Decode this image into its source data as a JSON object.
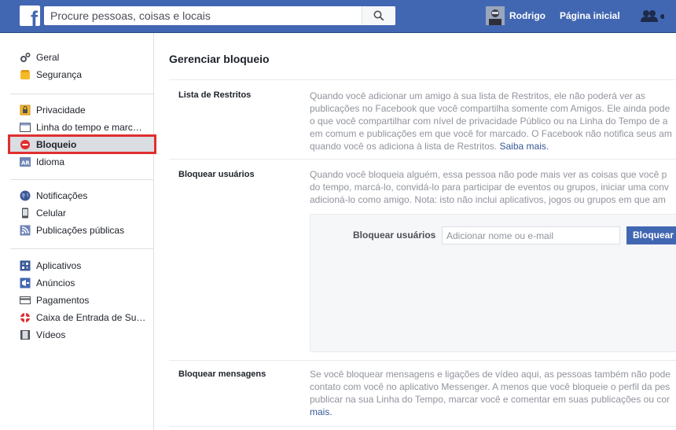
{
  "topbar": {
    "logo": "f",
    "search_placeholder": "Procure pessoas, coisas e locais",
    "user_name": "Rodrigo",
    "home_label": "Página inicial"
  },
  "sidebar": {
    "group1": [
      {
        "label": "Geral",
        "icon": "gears-icon"
      },
      {
        "label": "Segurança",
        "icon": "shield-icon"
      }
    ],
    "group2": [
      {
        "label": "Privacidade",
        "icon": "lock-icon"
      },
      {
        "label": "Linha do tempo e marc…",
        "icon": "timeline-icon"
      },
      {
        "label": "Bloqueio",
        "icon": "block-icon",
        "active": true
      },
      {
        "label": "Idioma",
        "icon": "language-icon"
      }
    ],
    "group3": [
      {
        "label": "Notificações",
        "icon": "globe-icon"
      },
      {
        "label": "Celular",
        "icon": "mobile-icon"
      },
      {
        "label": "Publicações públicas",
        "icon": "rss-icon"
      }
    ],
    "group4": [
      {
        "label": "Aplicativos",
        "icon": "apps-icon"
      },
      {
        "label": "Anúncios",
        "icon": "ads-icon"
      },
      {
        "label": "Pagamentos",
        "icon": "card-icon"
      },
      {
        "label": "Caixa de Entrada de Su…",
        "icon": "lifebuoy-icon"
      },
      {
        "label": "Vídeos",
        "icon": "film-icon"
      }
    ]
  },
  "main": {
    "title": "Gerenciar bloqueio",
    "restricted": {
      "label": "Lista de Restritos",
      "lines": [
        "Quando você adicionar um amigo à sua lista de Restritos, ele não poderá ver as",
        "publicações no Facebook que você compartilha somente com Amigos. Ele ainda pode",
        "o que você compartilhar com nível de privacidade Público ou na Linha do Tempo de a",
        "em comum e publicações em que você for marcado. O Facebook não notifica seus am"
      ],
      "last_line": "quando você os adiciona à lista de Restritos.",
      "link": "Saiba mais."
    },
    "block_users": {
      "label": "Bloquear usuários",
      "lines": [
        "Quando você bloqueia alguém, essa pessoa não pode mais ver as coisas que você p",
        "do tempo, marcá-lo, convidá-lo para participar de eventos ou grupos, iniciar uma conv",
        "adicioná-lo como amigo. Nota: isto não inclui aplicativos, jogos ou grupos em que am"
      ],
      "field_label": "Bloquear usuários",
      "input_placeholder": "Adicionar nome ou e-mail",
      "button_label": "Bloquear"
    },
    "block_messages": {
      "label": "Bloquear mensagens",
      "lines": [
        "Se você bloquear mensagens e ligações de vídeo aqui, as pessoas também não pode",
        "contato com você no aplicativo Messenger. A menos que você bloqueie o perfil da pes",
        "publicar na sua Linha do Tempo, marcar você e comentar em suas publicações ou cor"
      ],
      "link": "mais."
    }
  },
  "colors": {
    "topbar": "#4267b2",
    "highlight": "#e02f2f",
    "link": "#365899"
  }
}
